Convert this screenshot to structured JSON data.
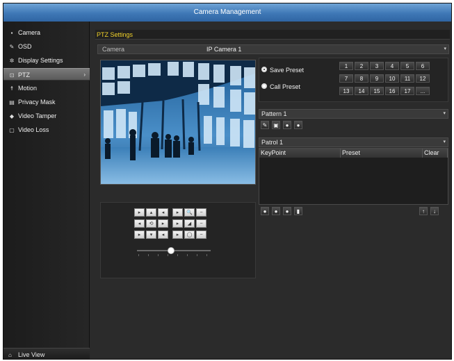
{
  "window": {
    "title": "Camera Management"
  },
  "sidebar": {
    "items": [
      {
        "label": "Camera",
        "icon": "camera-icon",
        "glyph": "▪"
      },
      {
        "label": "OSD",
        "icon": "osd-icon",
        "glyph": "✎"
      },
      {
        "label": "Display Settings",
        "icon": "display-settings-icon",
        "glyph": "✲"
      },
      {
        "label": "PTZ",
        "icon": "ptz-icon",
        "glyph": "⊡"
      },
      {
        "label": "Motion",
        "icon": "motion-icon",
        "glyph": "☨"
      },
      {
        "label": "Privacy Mask",
        "icon": "privacy-mask-icon",
        "glyph": "▤"
      },
      {
        "label": "Video Tamper",
        "icon": "video-tamper-icon",
        "glyph": "◆"
      },
      {
        "label": "Video Loss",
        "icon": "video-loss-icon",
        "glyph": "▢"
      }
    ],
    "active_index": 3,
    "active_chevron": "›",
    "live_view": {
      "label": "Live View",
      "glyph": "⌂"
    }
  },
  "main": {
    "section_title": "PTZ Settings",
    "camera": {
      "label": "Camera",
      "value": "IP Camera 1",
      "arrow": "▾"
    },
    "preset": {
      "save_label": "Save Preset",
      "call_label": "Call Preset",
      "selected": "save",
      "buttons_row1": [
        "1",
        "2",
        "3",
        "4",
        "5",
        "6"
      ],
      "buttons_row2": [
        "7",
        "8",
        "9",
        "10",
        "11",
        "12"
      ],
      "buttons_row3": [
        "13",
        "14",
        "15",
        "16",
        "17",
        "..."
      ]
    },
    "pattern": {
      "value": "Pattern 1",
      "arrow": "▾",
      "tools": [
        "✎",
        "▣",
        "●",
        "●"
      ]
    },
    "patrol": {
      "value": "Patrol 1",
      "arrow": "▾",
      "columns": [
        "KeyPoint",
        "Preset",
        "Clear"
      ],
      "tools_left": [
        "●",
        "●",
        "●",
        "▮"
      ],
      "tools_right": [
        "↑",
        "↓"
      ]
    },
    "ptz_control": {
      "buttons": [
        "▸",
        "▴",
        "◂",
        "▸",
        "🔍",
        "−",
        "◂",
        "⟲",
        "▸",
        "▸",
        "◢",
        "−",
        "▸",
        "▾",
        "◂",
        "▸",
        "◯",
        "−"
      ]
    }
  },
  "colors": {
    "title_bar": "#3f78b6",
    "section_title": "#f2d22a",
    "active_item": "#6a6a6a"
  }
}
